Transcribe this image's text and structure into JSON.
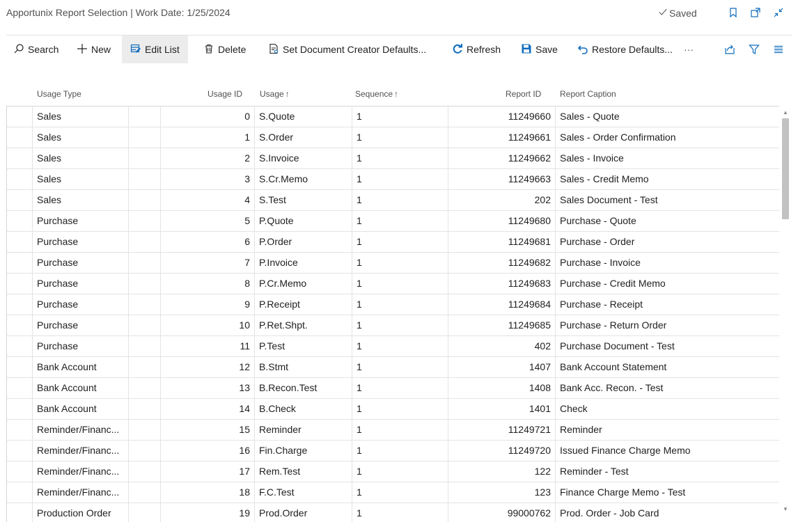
{
  "window": {
    "title": "Apportunix Report Selection | Work Date: 1/25/2024",
    "saved_label": "Saved"
  },
  "actions": {
    "search": "Search",
    "new": "New",
    "edit_list": "Edit List",
    "delete": "Delete",
    "set_document_creator_defaults": "Set Document Creator Defaults...",
    "refresh": "Refresh",
    "save": "Save",
    "restore_defaults": "Restore Defaults...",
    "more": "···"
  },
  "columns": {
    "usage_type": "Usage Type",
    "usage_id": "Usage ID",
    "usage": "Usage",
    "sequence": "Sequence",
    "report_id": "Report ID",
    "report_caption": "Report Caption",
    "sort_arrow": "↑"
  },
  "rows": [
    {
      "usage_type": "Sales",
      "usage_id": "0",
      "usage": "S.Quote",
      "sequence": "1",
      "report_id": "11249660",
      "report_caption": "Sales - Quote"
    },
    {
      "usage_type": "Sales",
      "usage_id": "1",
      "usage": "S.Order",
      "sequence": "1",
      "report_id": "11249661",
      "report_caption": "Sales - Order Confirmation"
    },
    {
      "usage_type": "Sales",
      "usage_id": "2",
      "usage": "S.Invoice",
      "sequence": "1",
      "report_id": "11249662",
      "report_caption": "Sales - Invoice"
    },
    {
      "usage_type": "Sales",
      "usage_id": "3",
      "usage": "S.Cr.Memo",
      "sequence": "1",
      "report_id": "11249663",
      "report_caption": "Sales - Credit Memo"
    },
    {
      "usage_type": "Sales",
      "usage_id": "4",
      "usage": "S.Test",
      "sequence": "1",
      "report_id": "202",
      "report_caption": "Sales Document - Test"
    },
    {
      "usage_type": "Purchase",
      "usage_id": "5",
      "usage": "P.Quote",
      "sequence": "1",
      "report_id": "11249680",
      "report_caption": "Purchase - Quote"
    },
    {
      "usage_type": "Purchase",
      "usage_id": "6",
      "usage": "P.Order",
      "sequence": "1",
      "report_id": "11249681",
      "report_caption": "Purchase - Order"
    },
    {
      "usage_type": "Purchase",
      "usage_id": "7",
      "usage": "P.Invoice",
      "sequence": "1",
      "report_id": "11249682",
      "report_caption": "Purchase - Invoice"
    },
    {
      "usage_type": "Purchase",
      "usage_id": "8",
      "usage": "P.Cr.Memo",
      "sequence": "1",
      "report_id": "11249683",
      "report_caption": "Purchase - Credit Memo"
    },
    {
      "usage_type": "Purchase",
      "usage_id": "9",
      "usage": "P.Receipt",
      "sequence": "1",
      "report_id": "11249684",
      "report_caption": "Purchase - Receipt"
    },
    {
      "usage_type": "Purchase",
      "usage_id": "10",
      "usage": "P.Ret.Shpt.",
      "sequence": "1",
      "report_id": "11249685",
      "report_caption": "Purchase - Return Order"
    },
    {
      "usage_type": "Purchase",
      "usage_id": "11",
      "usage": "P.Test",
      "sequence": "1",
      "report_id": "402",
      "report_caption": "Purchase Document - Test"
    },
    {
      "usage_type": "Bank Account",
      "usage_id": "12",
      "usage": "B.Stmt",
      "sequence": "1",
      "report_id": "1407",
      "report_caption": "Bank Account Statement"
    },
    {
      "usage_type": "Bank Account",
      "usage_id": "13",
      "usage": "B.Recon.Test",
      "sequence": "1",
      "report_id": "1408",
      "report_caption": "Bank Acc. Recon. - Test"
    },
    {
      "usage_type": "Bank Account",
      "usage_id": "14",
      "usage": "B.Check",
      "sequence": "1",
      "report_id": "1401",
      "report_caption": "Check"
    },
    {
      "usage_type": "Reminder/Financ...",
      "usage_id": "15",
      "usage": "Reminder",
      "sequence": "1",
      "report_id": "11249721",
      "report_caption": "Reminder"
    },
    {
      "usage_type": "Reminder/Financ...",
      "usage_id": "16",
      "usage": "Fin.Charge",
      "sequence": "1",
      "report_id": "11249720",
      "report_caption": "Issued Finance Charge Memo"
    },
    {
      "usage_type": "Reminder/Financ...",
      "usage_id": "17",
      "usage": "Rem.Test",
      "sequence": "1",
      "report_id": "122",
      "report_caption": "Reminder - Test"
    },
    {
      "usage_type": "Reminder/Financ...",
      "usage_id": "18",
      "usage": "F.C.Test",
      "sequence": "1",
      "report_id": "123",
      "report_caption": "Finance Charge Memo - Test"
    },
    {
      "usage_type": "Production Order",
      "usage_id": "19",
      "usage": "Prod.Order",
      "sequence": "1",
      "report_id": "99000762",
      "report_caption": "Prod. Order - Job Card"
    }
  ],
  "colors": {
    "accent": "#0f6cbd",
    "header_text": "#505050",
    "grid_line": "#e3e3e3",
    "active_action_bg": "#ececec"
  },
  "icons": {
    "saved": "check-icon",
    "bookmark": "bookmark-icon",
    "open_new_window": "open-in-new-window-icon",
    "collapse": "collapse-icon",
    "search": "search-icon",
    "new": "plus-icon",
    "edit_list": "edit-list-icon",
    "delete": "trash-icon",
    "set_defaults": "document-settings-icon",
    "refresh": "refresh-icon",
    "save": "save-icon",
    "restore": "undo-icon",
    "share": "share-icon",
    "filter": "filter-icon",
    "list_view": "list-view-icon",
    "scroll_up": "scroll-up-arrow-icon",
    "scroll_down": "scroll-down-arrow-icon"
  }
}
